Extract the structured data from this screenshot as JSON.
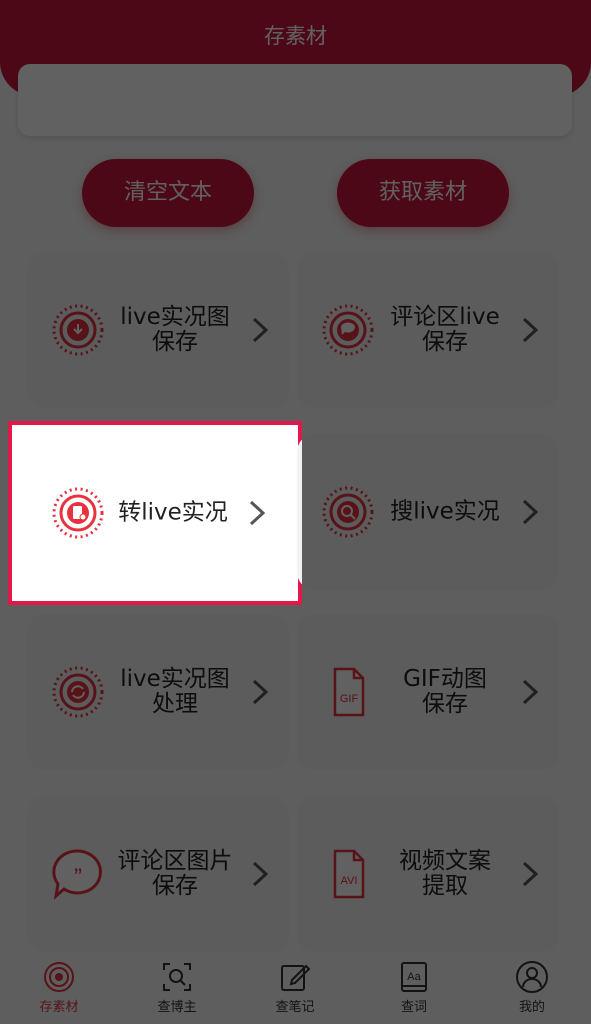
{
  "header": {
    "title": "存素材"
  },
  "buttons": {
    "clear_text": "清空文本",
    "get_material": "获取素材"
  },
  "cards": [
    {
      "id": "live-photo-save",
      "label": "live实况图\n保存",
      "icon": "live-photo-icon"
    },
    {
      "id": "comment-live-save",
      "label": "评论区live\n保存",
      "icon": "comment-live-icon"
    },
    {
      "id": "convert-live",
      "label": "转live实况",
      "icon": "convert-live-icon"
    },
    {
      "id": "search-live",
      "label": "搜live实况",
      "icon": "search-live-icon"
    },
    {
      "id": "live-photo-process",
      "label": "live实况图\n处理",
      "icon": "process-live-icon"
    },
    {
      "id": "gif-save",
      "label": "GIF动图\n保存",
      "icon": "gif-file-icon"
    },
    {
      "id": "comment-image-save",
      "label": "评论区图片\n保存",
      "icon": "quote-icon"
    },
    {
      "id": "video-text-extract",
      "label": "视频文案\n提取",
      "icon": "avi-file-icon"
    }
  ],
  "gif_badge": "GIF",
  "avi_badge": "AVI",
  "tabbar": [
    {
      "label": "存素材",
      "icon": "target-icon",
      "active": true
    },
    {
      "label": "查博主",
      "icon": "scan-search-icon",
      "active": false
    },
    {
      "label": "查笔记",
      "icon": "edit-icon",
      "active": false
    },
    {
      "label": "查词",
      "icon": "dictionary-icon",
      "active": false,
      "icon_text": "Aa"
    },
    {
      "label": "我的",
      "icon": "profile-icon",
      "active": false
    }
  ],
  "colors": {
    "brand": "#c8173a",
    "highlight_border": "#e0194a",
    "icon_red": "#e8323f",
    "tab_inactive": "#333333"
  }
}
